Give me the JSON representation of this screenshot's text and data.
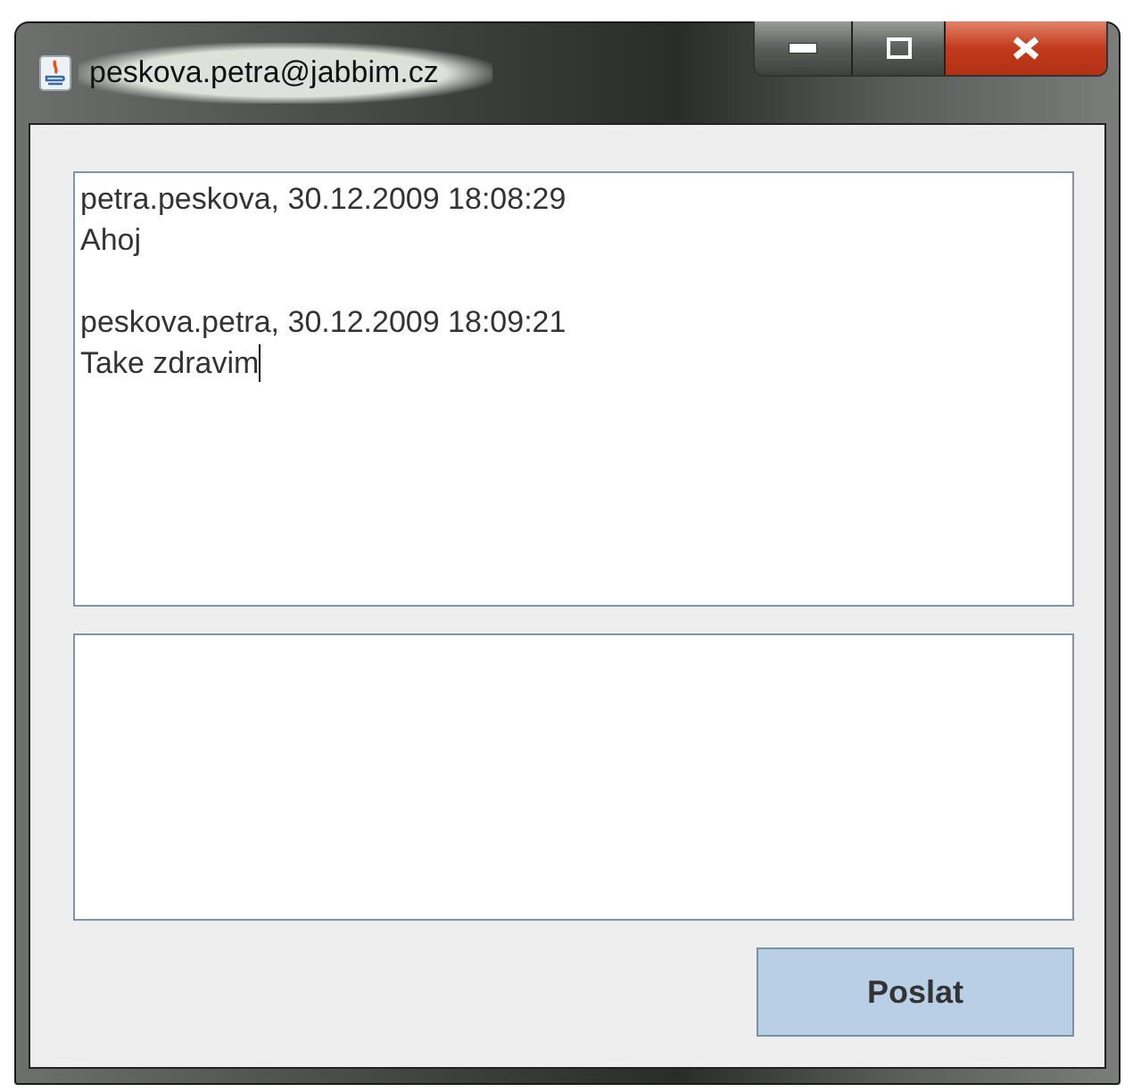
{
  "window": {
    "title": "peskova.petra@jabbim.cz"
  },
  "messages": [
    {
      "header": "petra.peskova, 30.12.2009 18:08:29",
      "text": "Ahoj"
    },
    {
      "header": "peskova.petra, 30.12.2009 18:09:21",
      "text": "Take zdravim"
    }
  ],
  "buttons": [
    {
      "label": "Poslat"
    }
  ]
}
